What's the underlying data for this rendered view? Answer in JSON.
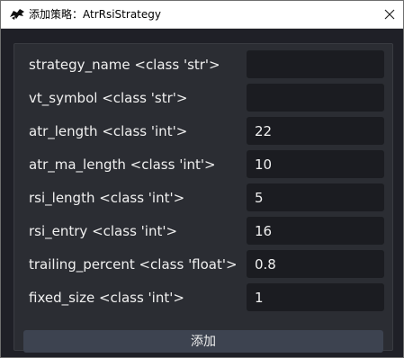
{
  "window": {
    "title": "添加策略：AtrRsiStrategy"
  },
  "form": {
    "fields": [
      {
        "label": "strategy_name <class 'str'>",
        "value": ""
      },
      {
        "label": "vt_symbol <class 'str'>",
        "value": ""
      },
      {
        "label": "atr_length <class 'int'>",
        "value": "22"
      },
      {
        "label": "atr_ma_length <class 'int'>",
        "value": "10"
      },
      {
        "label": "rsi_length <class 'int'>",
        "value": "5"
      },
      {
        "label": "rsi_entry <class 'int'>",
        "value": "16"
      },
      {
        "label": "trailing_percent <class 'float'>",
        "value": "0.8"
      },
      {
        "label": "fixed_size <class 'int'>",
        "value": "1"
      }
    ],
    "submit_label": "添加"
  },
  "icons": {
    "app": "app-logo-icon",
    "close": "close-icon"
  },
  "colors": {
    "background": "#1f2027",
    "panel": "#2b2d33",
    "input": "#1b1c21",
    "button": "#3d4350",
    "text": "#f0f0f0"
  }
}
